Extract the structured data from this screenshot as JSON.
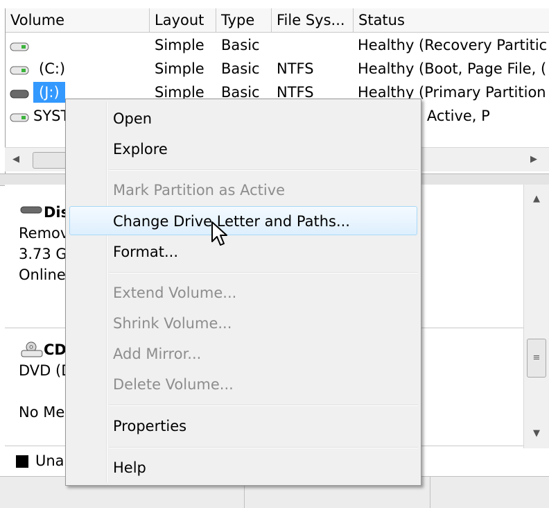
{
  "columns": [
    "Volume",
    "Layout",
    "Type",
    "File Sys...",
    "Status"
  ],
  "volumes": [
    {
      "volume": "",
      "layout": "Simple",
      "type": "Basic",
      "filesystem": "",
      "status": "Healthy (Recovery Partitic"
    },
    {
      "volume": "(C:)",
      "layout": "Simple",
      "type": "Basic",
      "filesystem": "NTFS",
      "status": "Healthy (Boot, Page File, ("
    },
    {
      "volume": "(J:)",
      "layout": "Simple",
      "type": "Basic",
      "filesystem": "NTFS",
      "status": "Healthy (Primary Partition"
    },
    {
      "volume": "SYST",
      "layout": "",
      "type": "",
      "filesystem": "",
      "status": "(System, Active, P"
    }
  ],
  "disks": [
    {
      "name": "Dis",
      "line1": "Remov",
      "line2": "3.73 G",
      "line3": "Online"
    },
    {
      "name": "CD",
      "line1": "DVD (D",
      "line2": "",
      "line3": "No Me"
    }
  ],
  "legend": {
    "label": "Una"
  },
  "context_menu": {
    "items": [
      {
        "label": "Open",
        "enabled": true
      },
      {
        "label": "Explore",
        "enabled": true
      },
      {
        "label": "Mark Partition as Active",
        "enabled": false
      },
      {
        "label": "Change Drive Letter and Paths...",
        "enabled": true,
        "highlighted": true
      },
      {
        "label": "Format...",
        "enabled": true
      },
      {
        "label": "Extend Volume...",
        "enabled": false
      },
      {
        "label": "Shrink Volume...",
        "enabled": false
      },
      {
        "label": "Add Mirror...",
        "enabled": false
      },
      {
        "label": "Delete Volume...",
        "enabled": false
      },
      {
        "label": "Properties",
        "enabled": true
      },
      {
        "label": "Help",
        "enabled": true
      }
    ]
  },
  "colors": {
    "selection": "#3399ff",
    "menu_bg": "#f0f0f0",
    "disabled_text": "#8d8d8d"
  }
}
